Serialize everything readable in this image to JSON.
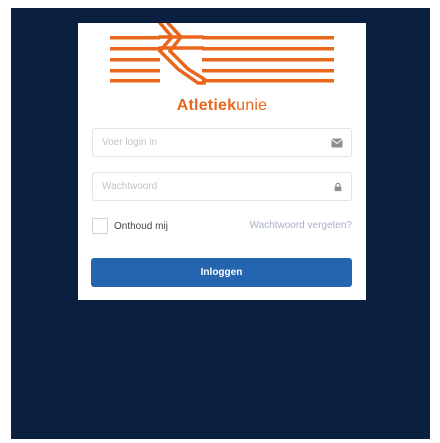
{
  "brand": {
    "name_bold": "Atletiek",
    "name_regular": "unie",
    "color": "#e8671c"
  },
  "form": {
    "login_placeholder": "Voer login in",
    "login_icon": "envelope-icon",
    "password_placeholder": "Wachtwoord",
    "password_icon": "lock-icon",
    "remember_label": "Onthoud mij",
    "remember_checked": false,
    "forgot_link": "Wachtwoord vergeten?",
    "submit_label": "Inloggen"
  },
  "colors": {
    "background": "#0b1f41",
    "button": "#2564ae",
    "link": "#a5afc6"
  }
}
